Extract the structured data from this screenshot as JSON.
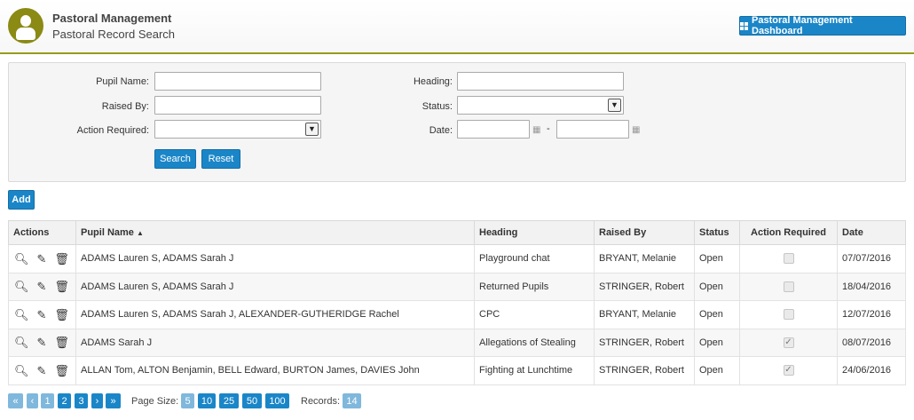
{
  "header": {
    "app_title": "Pastoral Management",
    "page_title": "Pastoral Record Search",
    "dashboard_button": "Pastoral Management Dashboard"
  },
  "filters": {
    "pupil_name_label": "Pupil Name:",
    "raised_by_label": "Raised By:",
    "action_required_label": "Action Required:",
    "heading_label": "Heading:",
    "status_label": "Status:",
    "date_label": "Date:",
    "date_separator": "-",
    "pupil_name_value": "",
    "raised_by_value": "",
    "heading_value": "",
    "status_value": "",
    "action_required_value": "",
    "date_from": "",
    "date_to": "",
    "search_button": "Search",
    "reset_button": "Reset"
  },
  "add_button": "Add",
  "table": {
    "columns": [
      "Actions",
      "Pupil Name",
      "Heading",
      "Raised By",
      "Status",
      "Action Required",
      "Date"
    ],
    "rows": [
      {
        "pupil": "ADAMS  Lauren S, ADAMS  Sarah J",
        "heading": "Playground chat",
        "raised_by": "BRYANT, Melanie",
        "status": "Open",
        "action_required": false,
        "date": "07/07/2016"
      },
      {
        "pupil": "ADAMS  Lauren S, ADAMS  Sarah J",
        "heading": "Returned Pupils",
        "raised_by": "STRINGER, Robert",
        "status": "Open",
        "action_required": false,
        "date": "18/04/2016"
      },
      {
        "pupil": "ADAMS  Lauren S, ADAMS  Sarah J, ALEXANDER-GUTHERIDGE  Rachel",
        "heading": "CPC",
        "raised_by": "BRYANT, Melanie",
        "status": "Open",
        "action_required": false,
        "date": "12/07/2016"
      },
      {
        "pupil": "ADAMS  Sarah J",
        "heading": "Allegations of Stealing",
        "raised_by": "STRINGER, Robert",
        "status": "Open",
        "action_required": true,
        "date": "08/07/2016"
      },
      {
        "pupil": "ALLAN  Tom, ALTON  Benjamin, BELL  Edward, BURTON  James, DAVIES  John",
        "heading": "Fighting at Lunchtime",
        "raised_by": "STRINGER, Robert",
        "status": "Open",
        "action_required": true,
        "date": "24/06/2016"
      }
    ]
  },
  "pager": {
    "pages": [
      "1",
      "2",
      "3"
    ],
    "page_size_label": "Page Size:",
    "page_sizes": [
      "5",
      "10",
      "25",
      "50",
      "100"
    ],
    "records_label": "Records:",
    "records_count": "14"
  },
  "icons": {
    "view": "search-icon",
    "edit": "pencil-icon",
    "delete": "trash-icon",
    "calendar": "calendar-icon",
    "dashboard": "grid-icon"
  },
  "colors": {
    "accent": "#1a86c8",
    "brand": "#8a8a14",
    "header_rule": "#9a9a1e"
  }
}
